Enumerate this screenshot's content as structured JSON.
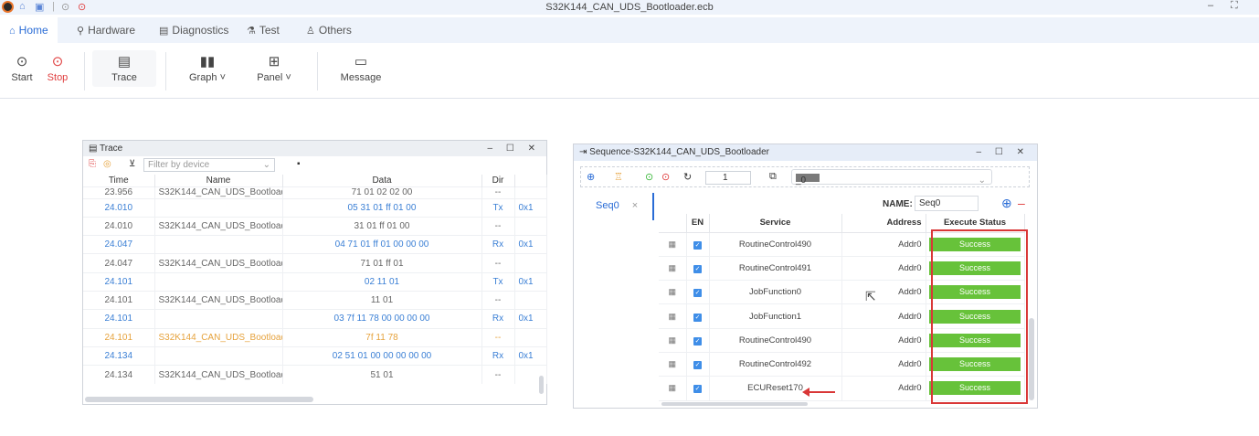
{
  "window": {
    "title": "S32K144_CAN_UDS_Bootloader.ecb",
    "minimize": "–",
    "maximize": "⛶"
  },
  "menu": {
    "tabs": [
      {
        "label": "Home",
        "icon": "home-icon"
      },
      {
        "label": "Hardware",
        "icon": "hardware-icon"
      },
      {
        "label": "Diagnostics",
        "icon": "diagnostics-icon"
      },
      {
        "label": "Test",
        "icon": "test-icon"
      },
      {
        "label": "Others",
        "icon": "others-icon"
      }
    ]
  },
  "toolbar": {
    "start": "Start",
    "stop": "Stop",
    "trace": "Trace",
    "graph": "Graph",
    "panel": "Panel",
    "message": "Message"
  },
  "trace": {
    "title": "Trace",
    "filter_placeholder": "Filter by device",
    "columns": [
      "Time",
      "Name",
      "Data",
      "Dir"
    ],
    "rows": [
      {
        "time": "23.956",
        "name": "S32K144_CAN_UDS_Bootload...",
        "data": "71 01 02 02 00",
        "dir": "--",
        "extra": "",
        "kind": "first"
      },
      {
        "time": "24.010",
        "name": "",
        "data": "05 31 01 ff 01 00",
        "dir": "Tx",
        "extra": "0x1",
        "kind": "tx"
      },
      {
        "time": "24.010",
        "name": "S32K144_CAN_UDS_Bootload...",
        "data": "31 01 ff 01 00",
        "dir": "--",
        "extra": "",
        "kind": "normal"
      },
      {
        "time": "24.047",
        "name": "",
        "data": "04 71 01 ff 01 00 00 00",
        "dir": "Rx",
        "extra": "0x1",
        "kind": "tx"
      },
      {
        "time": "24.047",
        "name": "S32K144_CAN_UDS_Bootload...",
        "data": "71 01 ff 01",
        "dir": "--",
        "extra": "",
        "kind": "normal"
      },
      {
        "time": "24.101",
        "name": "",
        "data": "02 11 01",
        "dir": "Tx",
        "extra": "0x1",
        "kind": "tx"
      },
      {
        "time": "24.101",
        "name": "S32K144_CAN_UDS_Bootload...",
        "data": "11 01",
        "dir": "--",
        "extra": "",
        "kind": "normal"
      },
      {
        "time": "24.101",
        "name": "",
        "data": "03 7f 11 78 00 00 00 00",
        "dir": "Rx",
        "extra": "0x1",
        "kind": "tx"
      },
      {
        "time": "24.101",
        "name": "S32K144_CAN_UDS_Bootload...",
        "data": "7f 11 78",
        "dir": "--",
        "extra": "",
        "kind": "hl"
      },
      {
        "time": "24.134",
        "name": "",
        "data": "02 51 01 00 00 00 00 00",
        "dir": "Rx",
        "extra": "0x1",
        "kind": "tx"
      },
      {
        "time": "24.134",
        "name": "S32K144_CAN_UDS_Bootload...",
        "data": "51 01",
        "dir": "--",
        "extra": "",
        "kind": "normal"
      }
    ]
  },
  "sequence": {
    "title": "Sequence-S32K144_CAN_UDS_Bootloader",
    "loop_count": "1",
    "channel": "_0",
    "tab": "Seq0",
    "tab_close": "×",
    "name_label": "NAME:",
    "name_value": "Seq0",
    "columns": [
      "EN",
      "Service",
      "Address",
      "Execute Status"
    ],
    "rows": [
      {
        "service": "RoutineControl490",
        "address": "Addr0",
        "status": "Success"
      },
      {
        "service": "RoutineControl491",
        "address": "Addr0",
        "status": "Success"
      },
      {
        "service": "JobFunction0",
        "address": "Addr0",
        "status": "Success"
      },
      {
        "service": "JobFunction1",
        "address": "Addr0",
        "status": "Success"
      },
      {
        "service": "RoutineControl490",
        "address": "Addr0",
        "status": "Success"
      },
      {
        "service": "RoutineControl492",
        "address": "Addr0",
        "status": "Success"
      },
      {
        "service": "ECUReset170",
        "address": "Addr0",
        "status": "Success"
      }
    ]
  },
  "colors": {
    "accent": "#2a6cd6",
    "success": "#67c23a",
    "highlight": "#d93737",
    "stop": "#e04040"
  }
}
